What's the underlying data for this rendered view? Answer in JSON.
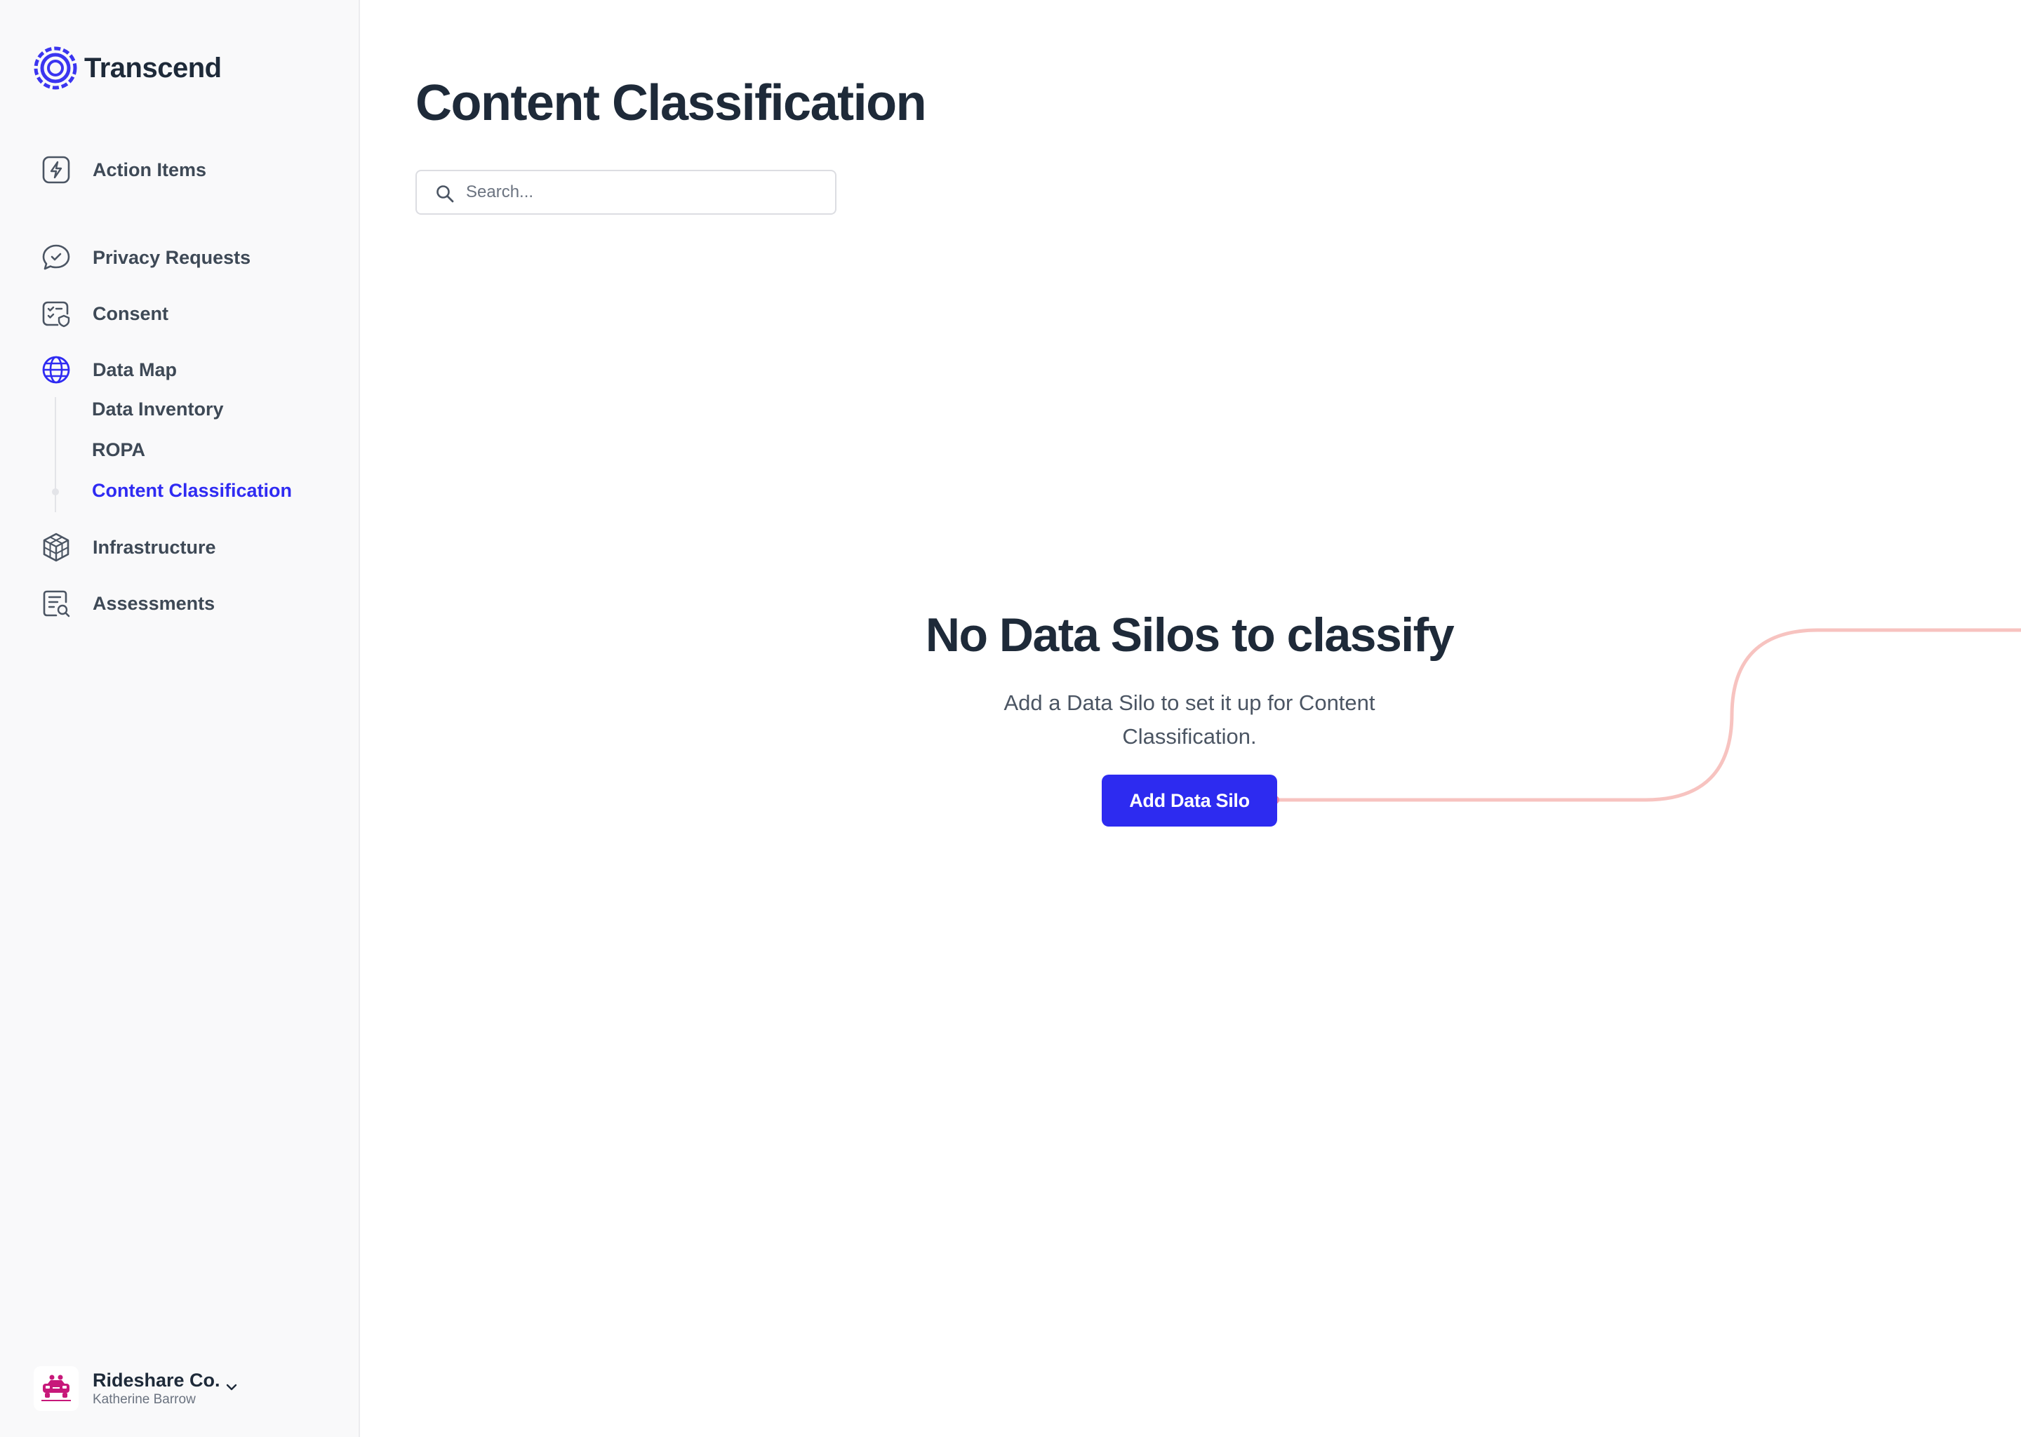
{
  "sidebar": {
    "brand": {
      "name": "Transcend",
      "icon": "transcend-logo-icon"
    },
    "nav": {
      "action_items": {
        "label": "Action Items",
        "icon": "lightning-icon"
      },
      "privacy_requests": {
        "label": "Privacy Requests",
        "icon": "chat-check-icon"
      },
      "consent": {
        "label": "Consent",
        "icon": "consent-icon"
      },
      "data_map": {
        "label": "Data Map",
        "icon": "globe-icon"
      },
      "infrastructure": {
        "label": "Infrastructure",
        "icon": "cube-icon"
      },
      "assessments": {
        "label": "Assessments",
        "icon": "document-search-icon"
      }
    },
    "data_map_children": [
      "Data Inventory",
      "ROPA",
      "Content Classification"
    ],
    "active_child": "Content Classification",
    "account": {
      "org": "Rideshare Co.",
      "user": "Katherine Barrow",
      "icon": "car-icon"
    }
  },
  "main": {
    "title": "Content Classification",
    "search": {
      "placeholder": "Search...",
      "value": ""
    },
    "empty_state": {
      "title": "No Data Silos to classify",
      "description": "Add a Data Silo to set it up for Content Classification.",
      "button_label": "Add Data Silo"
    }
  },
  "colors": {
    "accent": "#2d2bf0",
    "active_nav_text": "#2f2bf2",
    "connector_line": "#f7c3c0",
    "sidebar_bg": "#f9f9fa",
    "text_primary": "#1e2a39"
  }
}
